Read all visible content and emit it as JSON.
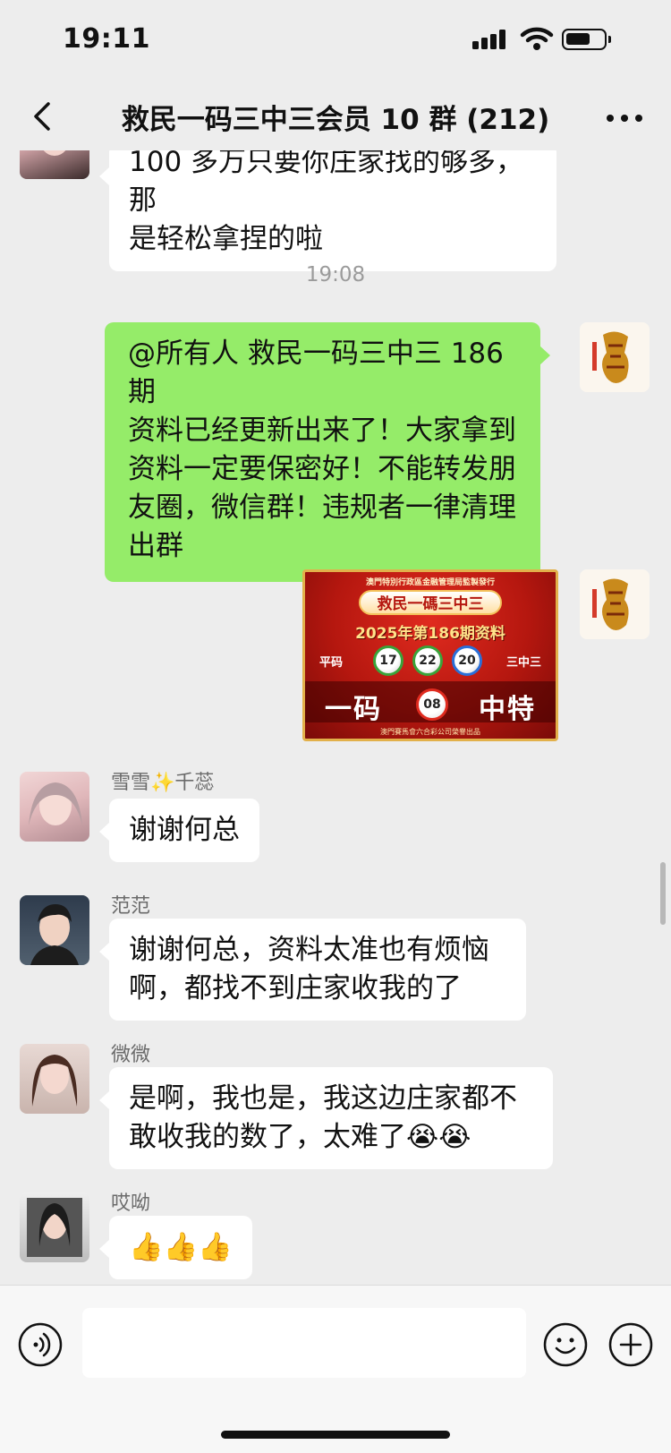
{
  "status_bar": {
    "time": "19:11"
  },
  "header": {
    "title": "救民一码三中三会员 10 群 (212)"
  },
  "messages": {
    "m0": {
      "text_line1": "100 多万只要你庄家找的够多，那",
      "text_line2": "是轻松拿捏的啦"
    },
    "time1": "19:08",
    "m1": {
      "lines": [
        "@所有人  救民一码三中三 186 期",
        "资料已经更新出来了！大家拿到",
        "资料一定要保密好！不能转发朋",
        "友圈，微信群！违规者一律清理",
        "出群"
      ]
    },
    "m2": {
      "image": {
        "top_text": "澳門特別行政區金融管理局監製發行",
        "title": "救民一碼三中三",
        "subtitle": "2025年第186期资料",
        "left_label": "平码",
        "right_label": "三中三",
        "balls": [
          "17",
          "22",
          "20"
        ],
        "big_left": "一码",
        "special": "08",
        "big_right": "中特",
        "footer": "澳門賽馬會六合彩公司榮譽出品"
      }
    },
    "m3": {
      "sender": "雪雪✨千蕊",
      "text": "谢谢何总"
    },
    "m4": {
      "sender": "范范",
      "text_line1": "谢谢何总，资料太准也有烦恼",
      "text_line2": "啊，都找不到庄家收我的了"
    },
    "m5": {
      "sender": "微微",
      "text_line1": "是啊，我也是，我这边庄家都不",
      "text_line2": "敢收我的数了，太难了😭😭"
    },
    "m6": {
      "sender": "哎呦",
      "text": "👍👍👍"
    }
  },
  "input": {
    "placeholder": ""
  },
  "colors": {
    "background": "#ededed",
    "outgoing_bubble": "#95ec69",
    "incoming_bubble": "#ffffff"
  },
  "icons": [
    "back-icon",
    "more-icon",
    "voice-icon",
    "emoji-icon",
    "plus-icon"
  ]
}
